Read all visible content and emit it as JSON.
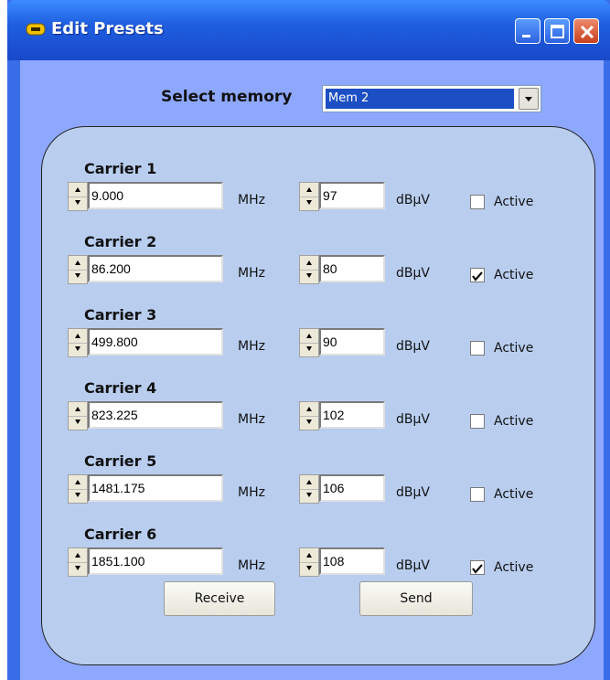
{
  "window": {
    "title": "Edit Presets"
  },
  "memory": {
    "label": "Select memory",
    "selected": "Mem 2"
  },
  "carriers": [
    {
      "label": "Carrier 1",
      "freq": "9.000",
      "freq_unit": "MHz",
      "level": "97",
      "level_unit": "dBµV",
      "active_label": "Active",
      "active": false
    },
    {
      "label": "Carrier 2",
      "freq": "86.200",
      "freq_unit": "MHz",
      "level": "80",
      "level_unit": "dBµV",
      "active_label": "Active",
      "active": true
    },
    {
      "label": "Carrier 3",
      "freq": "499.800",
      "freq_unit": "MHz",
      "level": "90",
      "level_unit": "dBµV",
      "active_label": "Active",
      "active": false
    },
    {
      "label": "Carrier 4",
      "freq": "823.225",
      "freq_unit": "MHz",
      "level": "102",
      "level_unit": "dBµV",
      "active_label": "Active",
      "active": false
    },
    {
      "label": "Carrier 5",
      "freq": "1481.175",
      "freq_unit": "MHz",
      "level": "106",
      "level_unit": "dBµV",
      "active_label": "Active",
      "active": false
    },
    {
      "label": "Carrier 6",
      "freq": "1851.100",
      "freq_unit": "MHz",
      "level": "108",
      "level_unit": "dBµV",
      "active_label": "Active",
      "active": true
    }
  ],
  "buttons": {
    "receive": "Receive",
    "send": "Send"
  }
}
